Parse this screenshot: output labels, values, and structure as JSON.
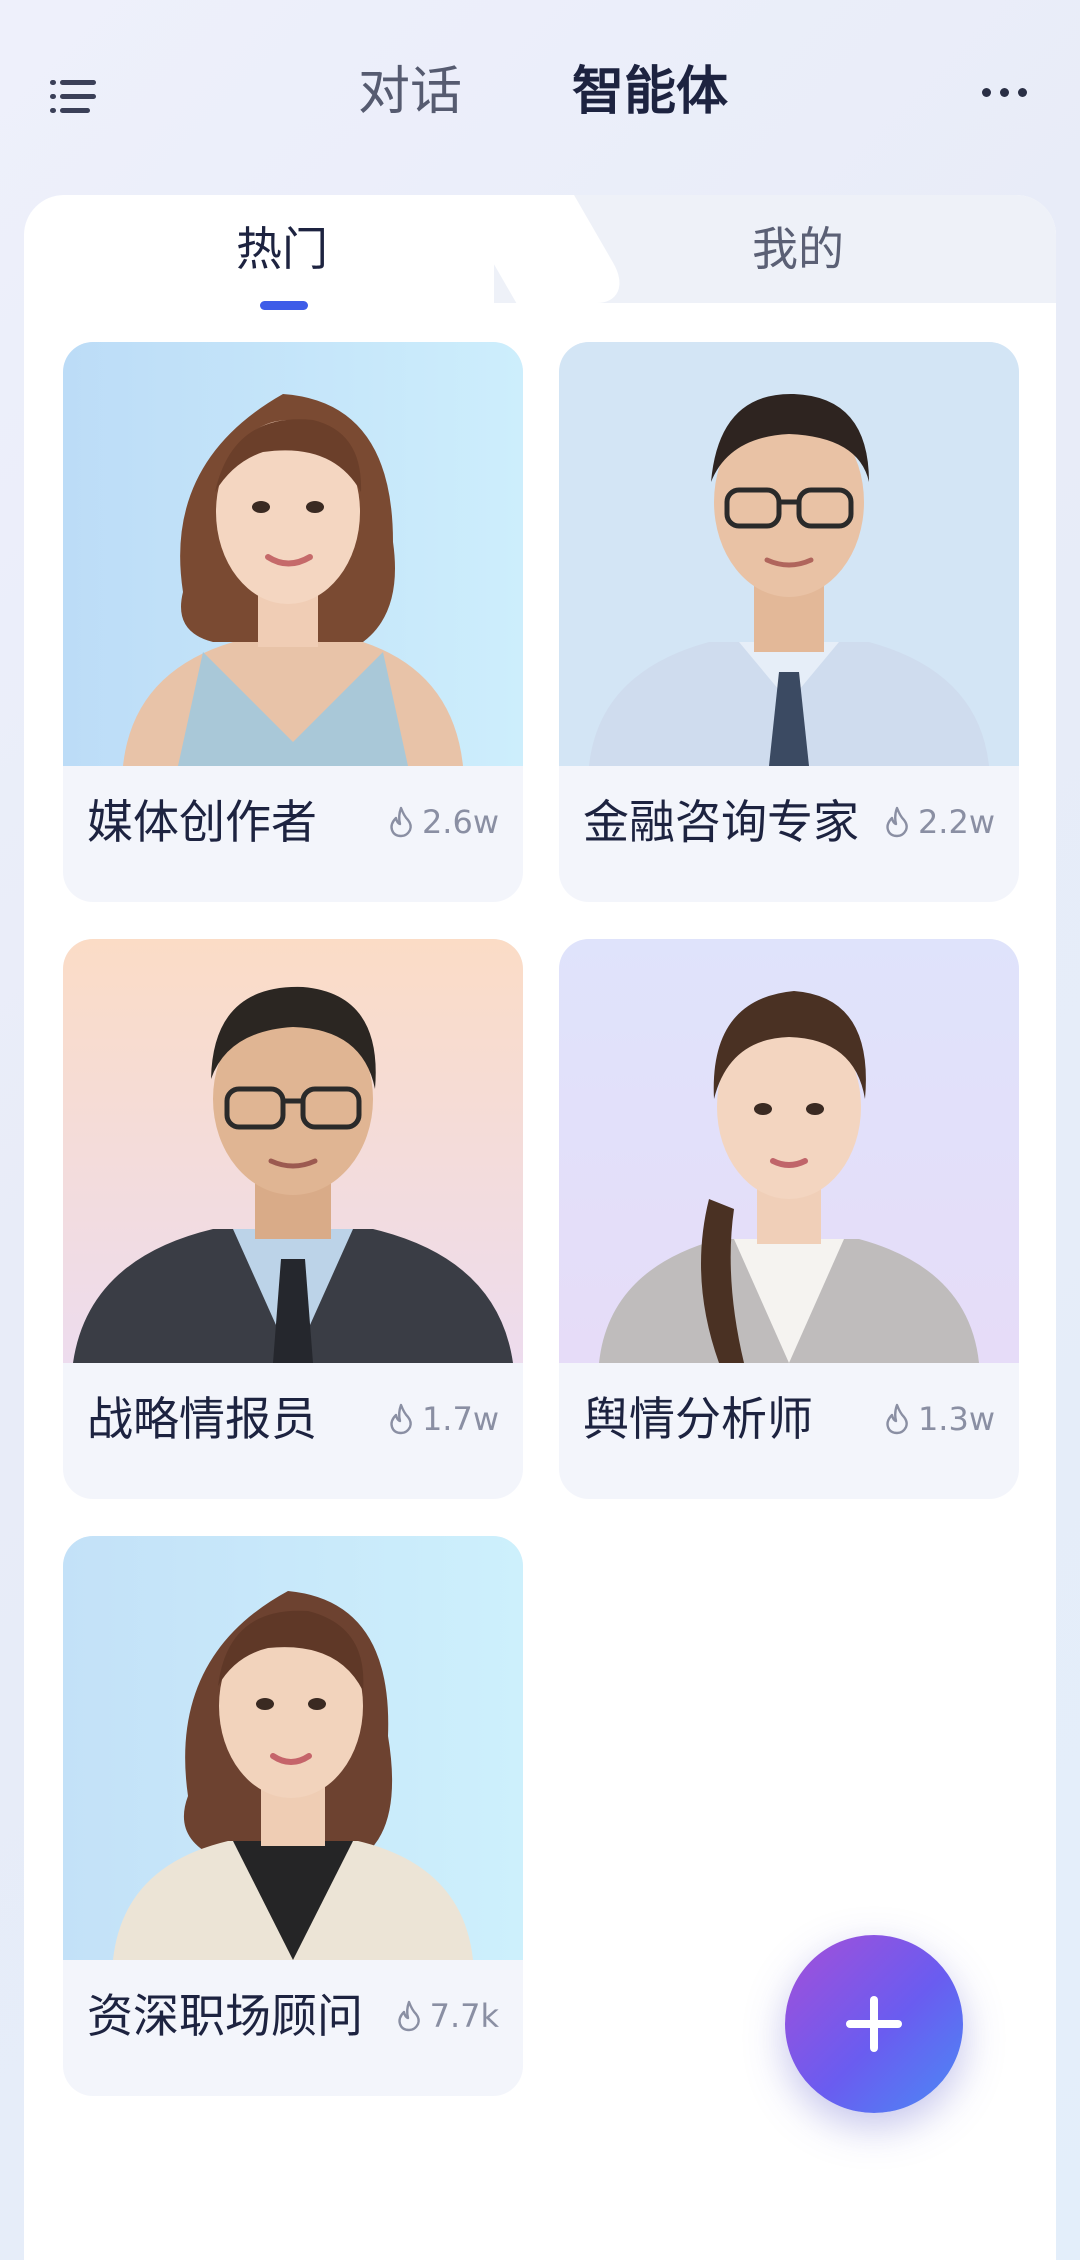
{
  "header": {
    "tabs": [
      {
        "label": "对话",
        "active": false
      },
      {
        "label": "智能体",
        "active": true
      }
    ],
    "menu_icon": "menu-list-icon",
    "more_icon": "more-dots-icon"
  },
  "subtabs": [
    {
      "label": "热门",
      "active": true
    },
    {
      "label": "我的",
      "active": false
    }
  ],
  "agents": [
    {
      "name": "媒体创作者",
      "heat": "2.6w",
      "avatar": "woman-wavy-hair-avatar"
    },
    {
      "name": "金融咨询专家",
      "heat": "2.2w",
      "avatar": "man-glasses-tie-avatar"
    },
    {
      "name": "战略情报员",
      "heat": "1.7w",
      "avatar": "man-suit-glasses-avatar"
    },
    {
      "name": "舆情分析师",
      "heat": "1.3w",
      "avatar": "woman-ponytail-avatar"
    },
    {
      "name": "资深职场顾问",
      "heat": "7.7k",
      "avatar": "woman-blazer-avatar"
    }
  ],
  "fab": {
    "icon": "plus-icon"
  },
  "colors": {
    "accent": "#3e5ce8",
    "fab_start": "#a54fd8",
    "fab_end": "#4a8af5",
    "text_primary": "#1d2340",
    "text_secondary": "#8a8fa3"
  }
}
